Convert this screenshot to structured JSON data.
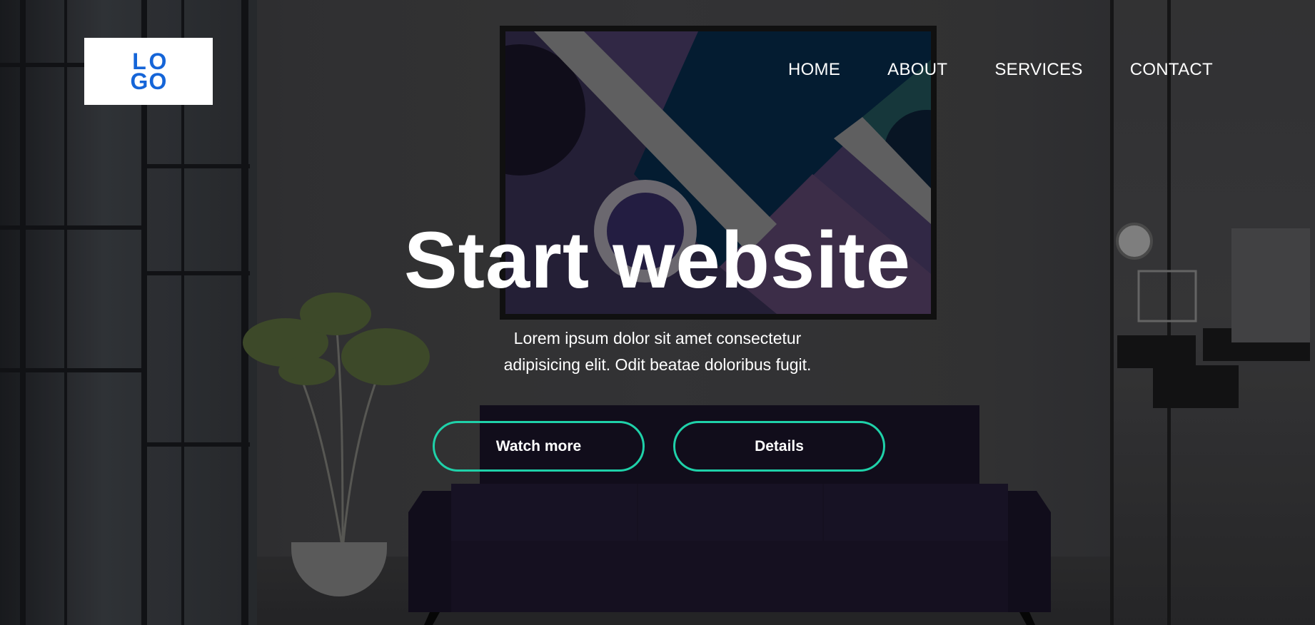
{
  "logo": {
    "letters": [
      "L",
      "O",
      "G",
      "O"
    ]
  },
  "nav": {
    "items": [
      {
        "label": "HOME"
      },
      {
        "label": "ABOUT"
      },
      {
        "label": "SERVICES"
      },
      {
        "label": "CONTACT"
      }
    ]
  },
  "hero": {
    "title": "Start website",
    "subtitle": "Lorem ipsum dolor sit amet consectetur adipisicing elit. Odit beatae doloribus fugit.",
    "buttons": {
      "watch_more": "Watch more",
      "details": "Details"
    }
  },
  "colors": {
    "accent": "#1fd1a9",
    "logo_blue": "#1565d8",
    "text": "#ffffff"
  }
}
